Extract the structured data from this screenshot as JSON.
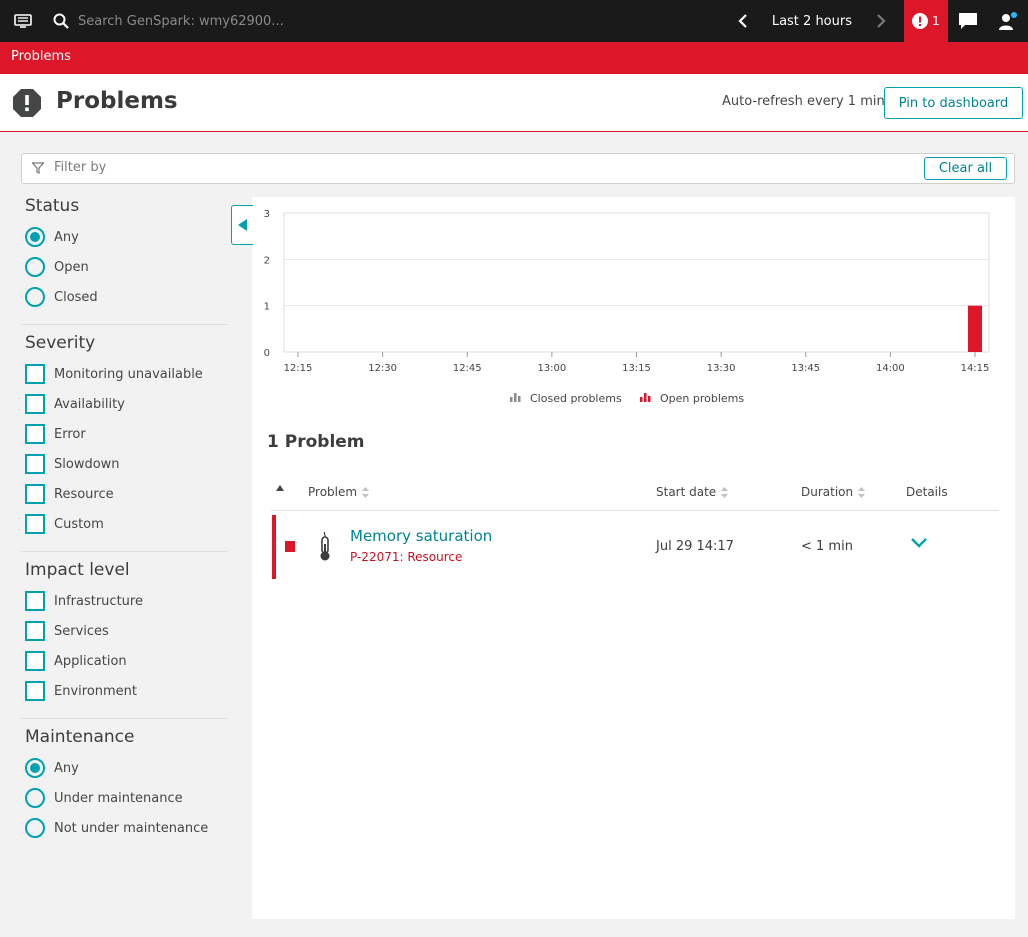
{
  "topbar": {
    "search_placeholder": "Search GenSpark: wmy62900...",
    "timeframe": "Last 2 hours",
    "problem_count": "1"
  },
  "breadcrumb": "Problems",
  "header": {
    "title": "Problems",
    "autorefresh": "Auto-refresh every 1 min",
    "pin_label": "Pin to dashboard"
  },
  "filter": {
    "placeholder": "Filter by",
    "clear_label": "Clear all"
  },
  "sidebar": {
    "status": {
      "title": "Status",
      "options": [
        {
          "label": "Any",
          "selected": true
        },
        {
          "label": "Open",
          "selected": false
        },
        {
          "label": "Closed",
          "selected": false
        }
      ]
    },
    "severity": {
      "title": "Severity",
      "options": [
        "Monitoring unavailable",
        "Availability",
        "Error",
        "Slowdown",
        "Resource",
        "Custom"
      ]
    },
    "impact": {
      "title": "Impact level",
      "options": [
        "Infrastructure",
        "Services",
        "Application",
        "Environment"
      ]
    },
    "maintenance": {
      "title": "Maintenance",
      "options": [
        {
          "label": "Any",
          "selected": true
        },
        {
          "label": "Under maintenance",
          "selected": false
        },
        {
          "label": "Not under maintenance",
          "selected": false
        }
      ]
    }
  },
  "chart_data": {
    "type": "bar",
    "categories": [
      "12:15",
      "12:30",
      "12:45",
      "13:00",
      "13:15",
      "13:30",
      "13:45",
      "14:00",
      "14:15"
    ],
    "series": [
      {
        "name": "Closed problems",
        "values": [
          0,
          0,
          0,
          0,
          0,
          0,
          0,
          0,
          0
        ]
      },
      {
        "name": "Open problems",
        "values": [
          0,
          0,
          0,
          0,
          0,
          0,
          0,
          0,
          1
        ]
      }
    ],
    "y_ticks": [
      "0",
      "1",
      "2",
      "3"
    ],
    "ylim": [
      0,
      3
    ],
    "legend_position": "bottom",
    "colors": {
      "closed": "#8c8c8c",
      "open": "#dc172a"
    }
  },
  "problems": {
    "count_label": "1 Problem",
    "columns": {
      "problem": "Problem",
      "start": "Start date",
      "duration": "Duration",
      "details": "Details"
    },
    "rows": [
      {
        "title": "Memory saturation",
        "id": "P-22071: Resource",
        "start": "Jul 29 14:17",
        "duration": "< 1 min"
      }
    ]
  },
  "colors": {
    "accent": "#00a1b2",
    "alert": "#dc172a",
    "link": "#00848f"
  }
}
